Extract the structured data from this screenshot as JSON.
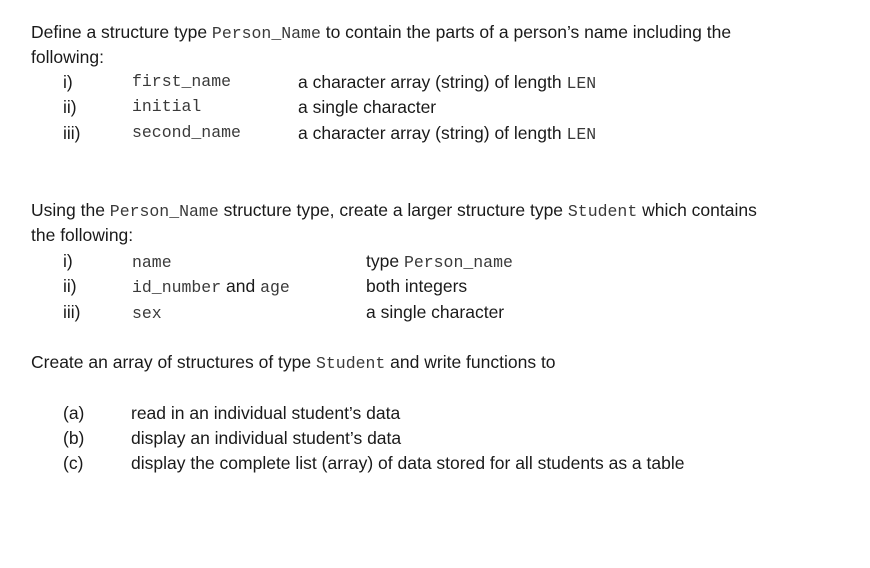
{
  "section1": {
    "intro_part1": "Define a structure type ",
    "intro_code": "Person_Name",
    "intro_part2": " to contain the parts of a person’s name including the",
    "intro_line2": "following:",
    "items": [
      {
        "num": "i)",
        "field": "first_name",
        "desc": "a character array (string) of length ",
        "desc_code": "LEN"
      },
      {
        "num": "ii)",
        "field": "initial",
        "desc": "a single character",
        "desc_code": ""
      },
      {
        "num": "iii)",
        "field": "second_name",
        "desc": "a character array (string) of length ",
        "desc_code": "LEN"
      }
    ]
  },
  "section2": {
    "intro_part1": "Using the ",
    "intro_code1": "Person_Name",
    "intro_part2": " structure type, create a larger structure type ",
    "intro_code2": "Student",
    "intro_part3": "  which contains",
    "intro_line2": "the following:",
    "items": [
      {
        "num": "i)",
        "field": "name",
        "field_and": "",
        "field2": "",
        "desc": "type ",
        "desc_code": "Person_name"
      },
      {
        "num": "ii)",
        "field": "id_number",
        "field_and": " and ",
        "field2": "age",
        "desc": "both integers",
        "desc_code": ""
      },
      {
        "num": "iii)",
        "field": "sex",
        "field_and": "",
        "field2": "",
        "desc": "a single character",
        "desc_code": ""
      }
    ]
  },
  "section3": {
    "intro_part1": "Create an array of structures of type ",
    "intro_code": "Student",
    "intro_part2": "  and write functions to",
    "items": [
      {
        "num": "(a)",
        "text": "read in an individual student’s data"
      },
      {
        "num": "(b)",
        "text": "display an individual student’s data"
      },
      {
        "num": "(c)",
        "text": "display the complete list (array) of data stored for all students as a table"
      }
    ]
  }
}
